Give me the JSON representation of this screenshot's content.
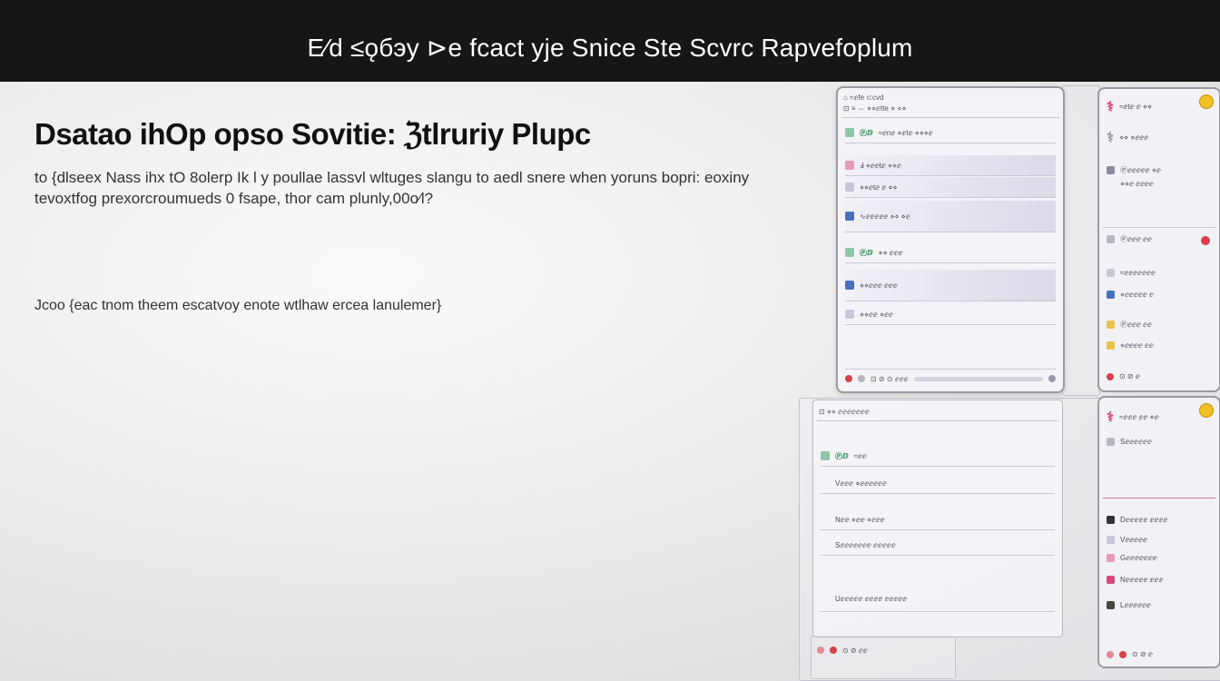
{
  "header": {
    "title": "E⁄d ≤ǫбэy ⊳e fcact yje Snice Ste Scvrc Rapvefoplum"
  },
  "main": {
    "heading": "Dsatao ihOp opso Sovitie: ℨtlruriy Plupc",
    "paragraph": "to {dlseex Nass ihx tO 8olerp Ik l y poullae lassvl wltuges slangu to aedl snere when yoruns bopri: eoxiny tevoxtfog prexorcroumueds 0 fsape, thor cam plunly,00o⁄l?",
    "note": "Jcoo {eac tnom theem escatvoy enote wtlhaw ercea lanulemer}"
  },
  "colors": {
    "topbar": "#161616",
    "accent_green": "#2a8a55",
    "accent_pink": "#d8467a",
    "accent_blue": "#4a6fc0",
    "badge_yellow": "#f0c020"
  },
  "mockup_top_main": {
    "header": "⌂ ≈ⅇfe ⊂cvd",
    "header_sub": "⊡ ≡ ⇔ ⋄⋄ⅇtte ⋄ ⋄⋄",
    "rows": [
      {
        "icon": "list-icon",
        "label_green": "Ⓟⅅ",
        "label": "≈ⅇnⅇ ⋄ⅇtⅇ ⋄⋄⋄ⅇ"
      },
      {
        "icon": "edit-icon",
        "label": "Ⅎ ⋄ⅇⅇtⅇ ⋄⋄ⅇ"
      },
      {
        "icon": "tag-icon",
        "label": "⋄⋄ⅇtⅇ ⅇ ⋄⋄"
      },
      {
        "icon": "pen-icon",
        "label": "∿ⅇⅇⅇⅇⅇ ⋄⋄ ⋄ⅇ"
      },
      {
        "icon": "flag-icon",
        "label_green": "Ⓟⅅ",
        "label": "⋄⋄ ⅇⅇⅇ"
      },
      {
        "icon": "pen-icon",
        "label": "⋄⋄ⅇⅇⅇ ⅇⅇⅇ"
      },
      {
        "icon": "doc-icon",
        "label": "⋄⋄ⅇⅇ ⋄ⅇⅇ"
      }
    ],
    "footer": "⊡ ⊘ ⊙ ⅇⅇⅇ"
  },
  "mockup_top_side": {
    "header": "≈ⅇtⅇ ⅇ ⋄⋄",
    "header_sub": "⋄⋄ ⋄ⅇⅇⅇ",
    "items": [
      {
        "icon": "image-icon",
        "label": "Ⓟⅇⅇⅇⅇⅇ ⋄ⅇ"
      },
      {
        "icon": "folder-icon",
        "label": "⋄⋄ⅇ ⅇⅇⅇⅇ"
      },
      {
        "icon": "user-icon",
        "label": "Ⓟⅇⅇⅇ ⅇⅇ"
      },
      {
        "icon": "doc-icon",
        "label": "≈ⅇⅇⅇⅇⅇⅇⅇ"
      },
      {
        "icon": "calendar-icon",
        "label": "⋄ⅇⅇⅇⅇⅇ ⅇ"
      },
      {
        "icon": "star-icon",
        "label": "Ⓟⅇⅇⅇ ⅇⅇ"
      },
      {
        "icon": "bell-icon",
        "label": "⋄ⅇⅇⅇⅇ ⅇⅇ"
      }
    ],
    "footer": "⊙ ⊘ ⅇ"
  },
  "mockup_bottom_main": {
    "header": "⊡ ⋄⋄ ⅇⅇⅇⅇⅇⅇⅇ",
    "rows": [
      {
        "icon": "list-icon",
        "label_green": "Ⓟⅅ",
        "label": "≈ⅇⅇ"
      },
      {
        "icon": "pen-icon",
        "label": "Vⅇⅇⅇ ⋄ⅇⅇⅇⅇⅇⅇ"
      },
      {
        "icon": "edit-icon",
        "label": "Nⅇⅇ ⋄ⅇⅇ ⋄ⅇⅇⅇ"
      },
      {
        "icon": "doc-icon",
        "label": "Sⅇⅇⅇⅇⅇⅇⅇ ⅇⅇⅇⅇⅇ"
      },
      {
        "icon": "note-icon",
        "label": "Uⅇⅇⅇⅇⅇ ⅇⅇⅇⅇ ⅇⅇⅇⅇⅇ"
      }
    ],
    "footer": "⊙ ⊘ ⅇⅇ"
  },
  "mockup_bottom_side": {
    "header": "≈ⅇⅇⅇ ⅇⅇ ⋄ⅇ",
    "items": [
      {
        "icon": "user-icon",
        "label": "Sⅇⅇⅇⅇⅇⅇ"
      },
      {
        "icon": "doc-icon",
        "label": "Dⅇⅇⅇⅇⅇ ⅇⅇⅇⅇ"
      },
      {
        "icon": "folder-icon",
        "label": "Vⅇⅇⅇⅇⅇ"
      },
      {
        "icon": "image-icon",
        "label": "Gⅇⅇⅇⅇⅇⅇⅇ"
      },
      {
        "icon": "tag-icon",
        "label": "Nⅇⅇⅇⅇⅇ ⅇⅇⅇ"
      },
      {
        "icon": "person-icon",
        "label": "Lⅇⅇⅇⅇⅇⅇ"
      }
    ],
    "footer": "⊙ ⊘ ⅇ"
  }
}
